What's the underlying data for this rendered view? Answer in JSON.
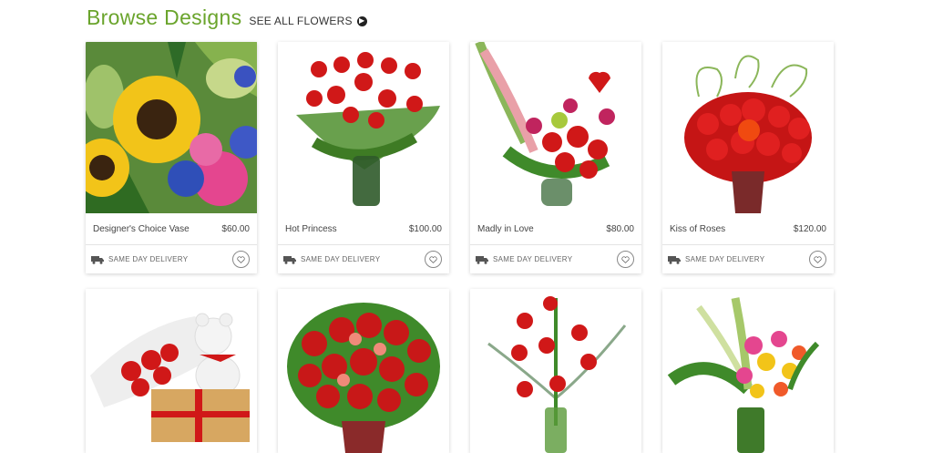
{
  "header": {
    "title": "Browse Designs",
    "see_all": "SEE ALL FLOWERS"
  },
  "products": [
    {
      "name": "Designer's Choice Vase",
      "price": "$60.00",
      "delivery": "SAME DAY DELIVERY"
    },
    {
      "name": "Hot Princess",
      "price": "$100.00",
      "delivery": "SAME DAY DELIVERY"
    },
    {
      "name": "Madly in Love",
      "price": "$80.00",
      "delivery": "SAME DAY DELIVERY"
    },
    {
      "name": "Kiss of Roses",
      "price": "$120.00",
      "delivery": "SAME DAY DELIVERY"
    }
  ],
  "colors": {
    "brand_green": "#6aa42c",
    "rose_red": "#d01818",
    "leaf_green": "#3f8a2a"
  },
  "icons": {
    "see_all": "arrow-circle-right-icon",
    "delivery": "truck-icon",
    "favorite": "heart-icon"
  }
}
